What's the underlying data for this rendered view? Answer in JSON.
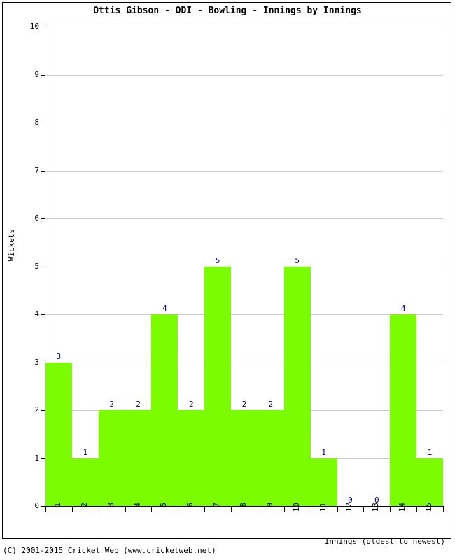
{
  "chart_data": {
    "type": "bar",
    "title": "Ottis Gibson - ODI - Bowling - Innings by Innings",
    "xlabel": "Innings (oldest to newest)",
    "ylabel": "Wickets",
    "categories": [
      "1",
      "2",
      "3",
      "4",
      "5",
      "6",
      "7",
      "8",
      "9",
      "10",
      "11",
      "12",
      "13",
      "14",
      "15"
    ],
    "values": [
      3,
      1,
      2,
      2,
      4,
      2,
      5,
      2,
      2,
      5,
      1,
      0,
      0,
      4,
      1
    ],
    "value_labels": [
      "3",
      "1",
      "2",
      "2",
      "4",
      "2",
      "5",
      "2",
      "2",
      "5",
      "1",
      "0",
      "0",
      "4",
      "1"
    ],
    "ylim": [
      0,
      10
    ],
    "y_ticks": [
      "0",
      "1",
      "2",
      "3",
      "4",
      "5",
      "6",
      "7",
      "8",
      "9",
      "10"
    ],
    "grid": true,
    "legend": "none",
    "bar_color": "#7CFC00",
    "value_label_color": "#000080",
    "grid_color": "#CCCCCC",
    "axis_color": "#000000"
  },
  "footer": {
    "copyright": "(C) 2001-2015 Cricket Web (www.cricketweb.net)"
  }
}
